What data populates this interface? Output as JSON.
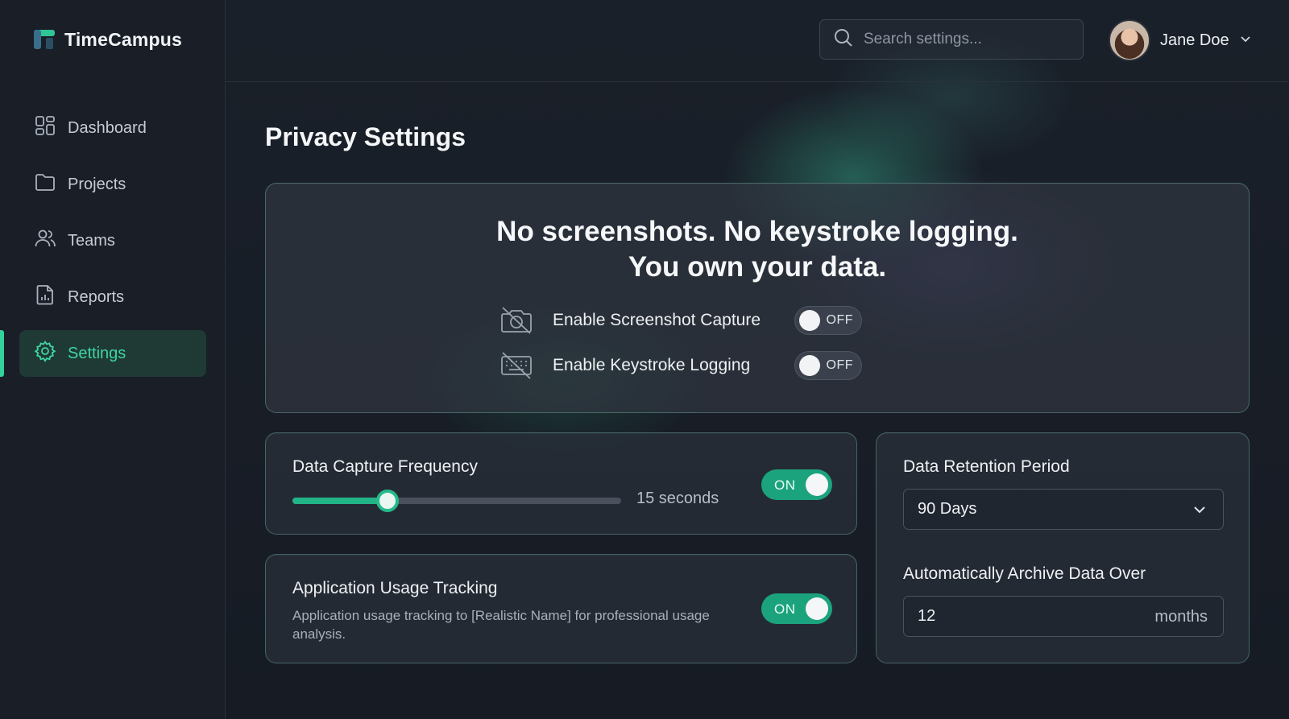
{
  "app": {
    "name": "TimeCampus",
    "accent": "#33d19b"
  },
  "sidebar": {
    "items": [
      {
        "label": "Dashboard",
        "icon": "dashboard-icon",
        "active": false
      },
      {
        "label": "Projects",
        "icon": "folder-icon",
        "active": false
      },
      {
        "label": "Teams",
        "icon": "users-icon",
        "active": false
      },
      {
        "label": "Reports",
        "icon": "report-icon",
        "active": false
      },
      {
        "label": "Settings",
        "icon": "gear-icon",
        "active": true
      }
    ]
  },
  "header": {
    "search": {
      "placeholder": "Search settings...",
      "value": ""
    },
    "user": {
      "name": "Jane Doe"
    }
  },
  "page": {
    "title": "Privacy Settings"
  },
  "privacy": {
    "headline_line1": "No screenshots. No keystroke logging.",
    "headline_line2": "You own your data.",
    "options": [
      {
        "label": "Enable Screenshot Capture",
        "icon": "camera-off-icon",
        "state": "OFF"
      },
      {
        "label": "Enable Keystroke Logging",
        "icon": "keyboard-off-icon",
        "state": "OFF"
      }
    ]
  },
  "capture_frequency": {
    "title": "Data Capture Frequency",
    "value_label": "15 seconds",
    "slider_fraction": 0.29,
    "toggle": "ON"
  },
  "usage_tracking": {
    "title": "Application Usage Tracking",
    "description": "Application usage tracking to [Realistic Name] for professional usage analysis.",
    "toggle": "ON"
  },
  "retention": {
    "title": "Data Retention Period",
    "selected": "90 Days",
    "archive_title": "Automatically Archive Data Over",
    "archive_value": "12",
    "archive_unit": "months"
  }
}
